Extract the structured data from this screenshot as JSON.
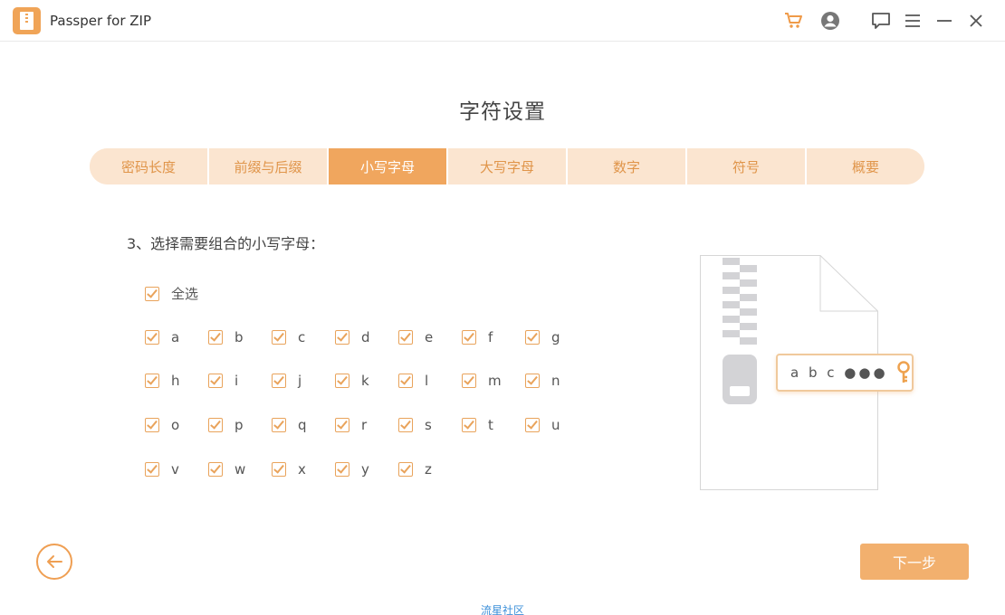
{
  "app": {
    "title": "Passper for ZIP"
  },
  "titlebar_icons": [
    "cart-icon",
    "account-icon",
    "feedback-icon",
    "menu-icon",
    "minimize-icon",
    "close-icon"
  ],
  "page_title": "字符设置",
  "tabs": [
    {
      "label": "密码长度",
      "active": false
    },
    {
      "label": "前缀与后缀",
      "active": false
    },
    {
      "label": "小写字母",
      "active": true
    },
    {
      "label": "大写字母",
      "active": false
    },
    {
      "label": "数字",
      "active": false
    },
    {
      "label": "符号",
      "active": false
    },
    {
      "label": "概要",
      "active": false
    }
  ],
  "prompt": "3、选择需要组合的小写字母：",
  "select_all": {
    "label": "全选",
    "checked": true
  },
  "letters": [
    {
      "label": "a",
      "checked": true
    },
    {
      "label": "b",
      "checked": true
    },
    {
      "label": "c",
      "checked": true
    },
    {
      "label": "d",
      "checked": true
    },
    {
      "label": "e",
      "checked": true
    },
    {
      "label": "f",
      "checked": true
    },
    {
      "label": "g",
      "checked": true
    },
    {
      "label": "h",
      "checked": true
    },
    {
      "label": "i",
      "checked": true
    },
    {
      "label": "j",
      "checked": true
    },
    {
      "label": "k",
      "checked": true
    },
    {
      "label": "l",
      "checked": true
    },
    {
      "label": "m",
      "checked": true
    },
    {
      "label": "n",
      "checked": true
    },
    {
      "label": "o",
      "checked": true
    },
    {
      "label": "p",
      "checked": true
    },
    {
      "label": "q",
      "checked": true
    },
    {
      "label": "r",
      "checked": true
    },
    {
      "label": "s",
      "checked": true
    },
    {
      "label": "t",
      "checked": true
    },
    {
      "label": "u",
      "checked": true
    },
    {
      "label": "v",
      "checked": true
    },
    {
      "label": "w",
      "checked": true
    },
    {
      "label": "x",
      "checked": true
    },
    {
      "label": "y",
      "checked": true
    },
    {
      "label": "z",
      "checked": true
    }
  ],
  "illustration": {
    "password_text": "a b c ●●●"
  },
  "buttons": {
    "next": "下一步"
  },
  "footer": {
    "text": "流星社区"
  },
  "colors": {
    "accent": "#f0a65e",
    "tab_bg": "#fbe5d0",
    "tab_text": "#e0954a",
    "link": "#3b8fd9"
  }
}
